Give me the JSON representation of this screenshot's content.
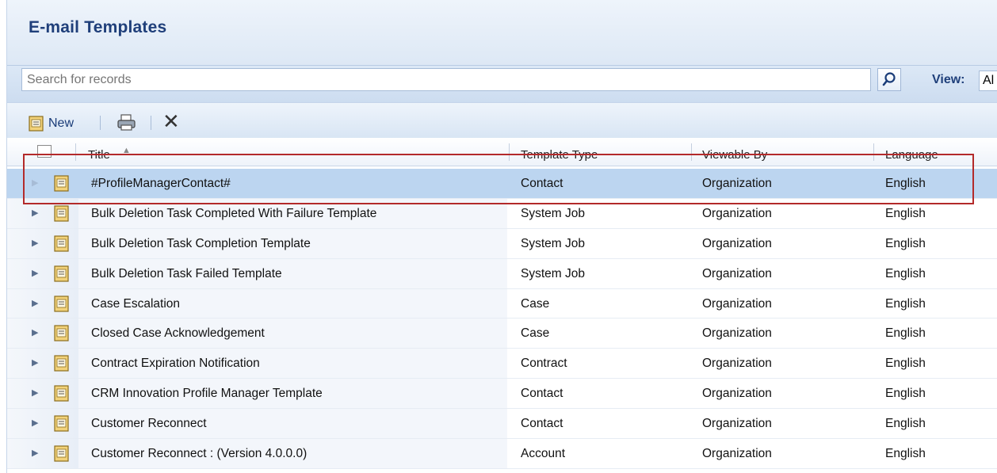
{
  "header": {
    "title": "E-mail Templates"
  },
  "search": {
    "placeholder": "Search for records",
    "view_label": "View:",
    "view_value": "Al"
  },
  "toolbar": {
    "new_label": "New"
  },
  "grid": {
    "columns": [
      "Title",
      "Template Type",
      "Viewable By",
      "Language"
    ],
    "rows": [
      {
        "title": "#ProfileManagerContact#",
        "type": "Contact",
        "viewable": "Organization",
        "language": "English"
      },
      {
        "title": "Bulk Deletion Task Completed With Failure Template",
        "type": "System Job",
        "viewable": "Organization",
        "language": "English"
      },
      {
        "title": "Bulk Deletion Task Completion Template",
        "type": "System Job",
        "viewable": "Organization",
        "language": "English"
      },
      {
        "title": "Bulk Deletion Task Failed Template",
        "type": "System Job",
        "viewable": "Organization",
        "language": "English"
      },
      {
        "title": "Case Escalation",
        "type": "Case",
        "viewable": "Organization",
        "language": "English"
      },
      {
        "title": "Closed Case Acknowledgement",
        "type": "Case",
        "viewable": "Organization",
        "language": "English"
      },
      {
        "title": "Contract Expiration Notification",
        "type": "Contract",
        "viewable": "Organization",
        "language": "English"
      },
      {
        "title": "CRM Innovation Profile Manager Template",
        "type": "Contact",
        "viewable": "Organization",
        "language": "English"
      },
      {
        "title": "Customer Reconnect",
        "type": "Contact",
        "viewable": "Organization",
        "language": "English"
      },
      {
        "title": "Customer Reconnect : (Version 4.0.0.0)",
        "type": "Account",
        "viewable": "Organization",
        "language": "English"
      }
    ]
  },
  "colors": {
    "title": "#1f3f7a",
    "selected_row": "#bcd5f0",
    "highlight": "#b32a2a"
  }
}
